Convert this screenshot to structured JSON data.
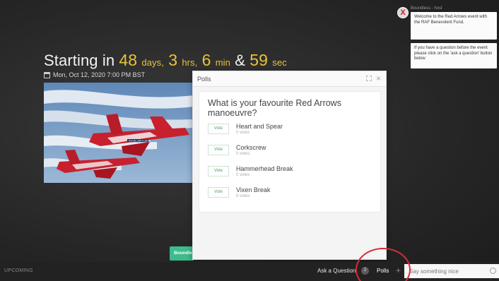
{
  "countdown": {
    "prefix": "Starting in",
    "days": "48",
    "days_unit": "days,",
    "hours": "3",
    "hours_unit": "hrs,",
    "minutes": "6",
    "minutes_unit": "min",
    "amp": "&",
    "seconds": "59",
    "seconds_unit": "sec"
  },
  "event_date": "Mon, Oct 12, 2020 7:00 PM BST",
  "event_image": {
    "tail_text": "ROYAL AIR FORCE"
  },
  "chat": {
    "host_initial": "X",
    "host_name": "Boundless - host",
    "messages": [
      "Welcome to the Red Arrows event with the RAF Benevolent Fund.",
      "If you have a question before the event please click on the 'ask a question' button below"
    ]
  },
  "polls": {
    "title": "Polls",
    "question": "What is your favourite Red Arrows manoeuvre?",
    "vote_label": "Vote",
    "options": [
      {
        "label": "Heart and Spear",
        "votes": "0 votes"
      },
      {
        "label": "Corkscrew",
        "votes": "0 votes"
      },
      {
        "label": "Hammerhead Break",
        "votes": "0 votes"
      },
      {
        "label": "Vixen Break",
        "votes": "0 votes"
      }
    ]
  },
  "green_tab_label": "Boundless",
  "bottom_bar": {
    "status": "UPCOMING",
    "ask_question": "Ask a Question",
    "ask_count": "2",
    "polls": "Polls",
    "plus": "+",
    "chat_placeholder": "Say something nice"
  },
  "colors": {
    "countdown_accent": "#e8c33b",
    "vote_green": "#4aa36b",
    "brand_green": "#3dbb8c",
    "highlight_red": "#d62b3c"
  }
}
